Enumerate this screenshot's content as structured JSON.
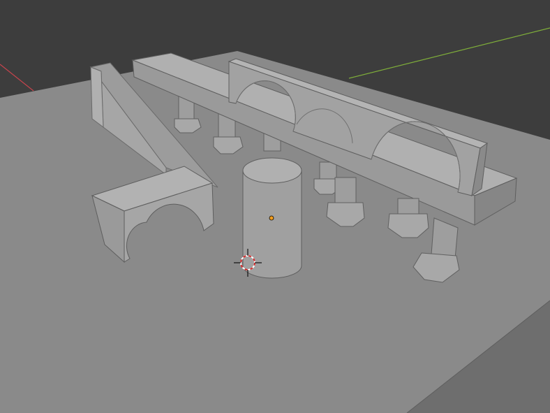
{
  "viewport": {
    "background_color": "#3d3d3d",
    "floor_top_color": "#8a8a8a",
    "floor_side_color": "#6e6e6e",
    "object_light": "#a8a8a8",
    "object_mid": "#969696",
    "object_dark": "#7a7a7a",
    "axis_x_color": "#c8444d",
    "axis_y_color": "#7fae3a",
    "origin_color": "#f29d1f",
    "cursor_colors": [
      "#d42b2b",
      "#ffffff",
      "#000000"
    ]
  },
  "objects": [
    {
      "id": "floor",
      "type": "plane"
    },
    {
      "id": "ramp",
      "type": "wedge"
    },
    {
      "id": "beam",
      "type": "box"
    },
    {
      "id": "arch-wall",
      "type": "wall-with-arches",
      "arch_count": 3
    },
    {
      "id": "arch-block",
      "type": "box-with-arch"
    },
    {
      "id": "cylinder",
      "type": "cylinder",
      "selected_origin": true
    },
    {
      "id": "pillars",
      "type": "pillar",
      "count": 8
    }
  ],
  "cursor": {
    "type": "3d-cursor-icon"
  }
}
